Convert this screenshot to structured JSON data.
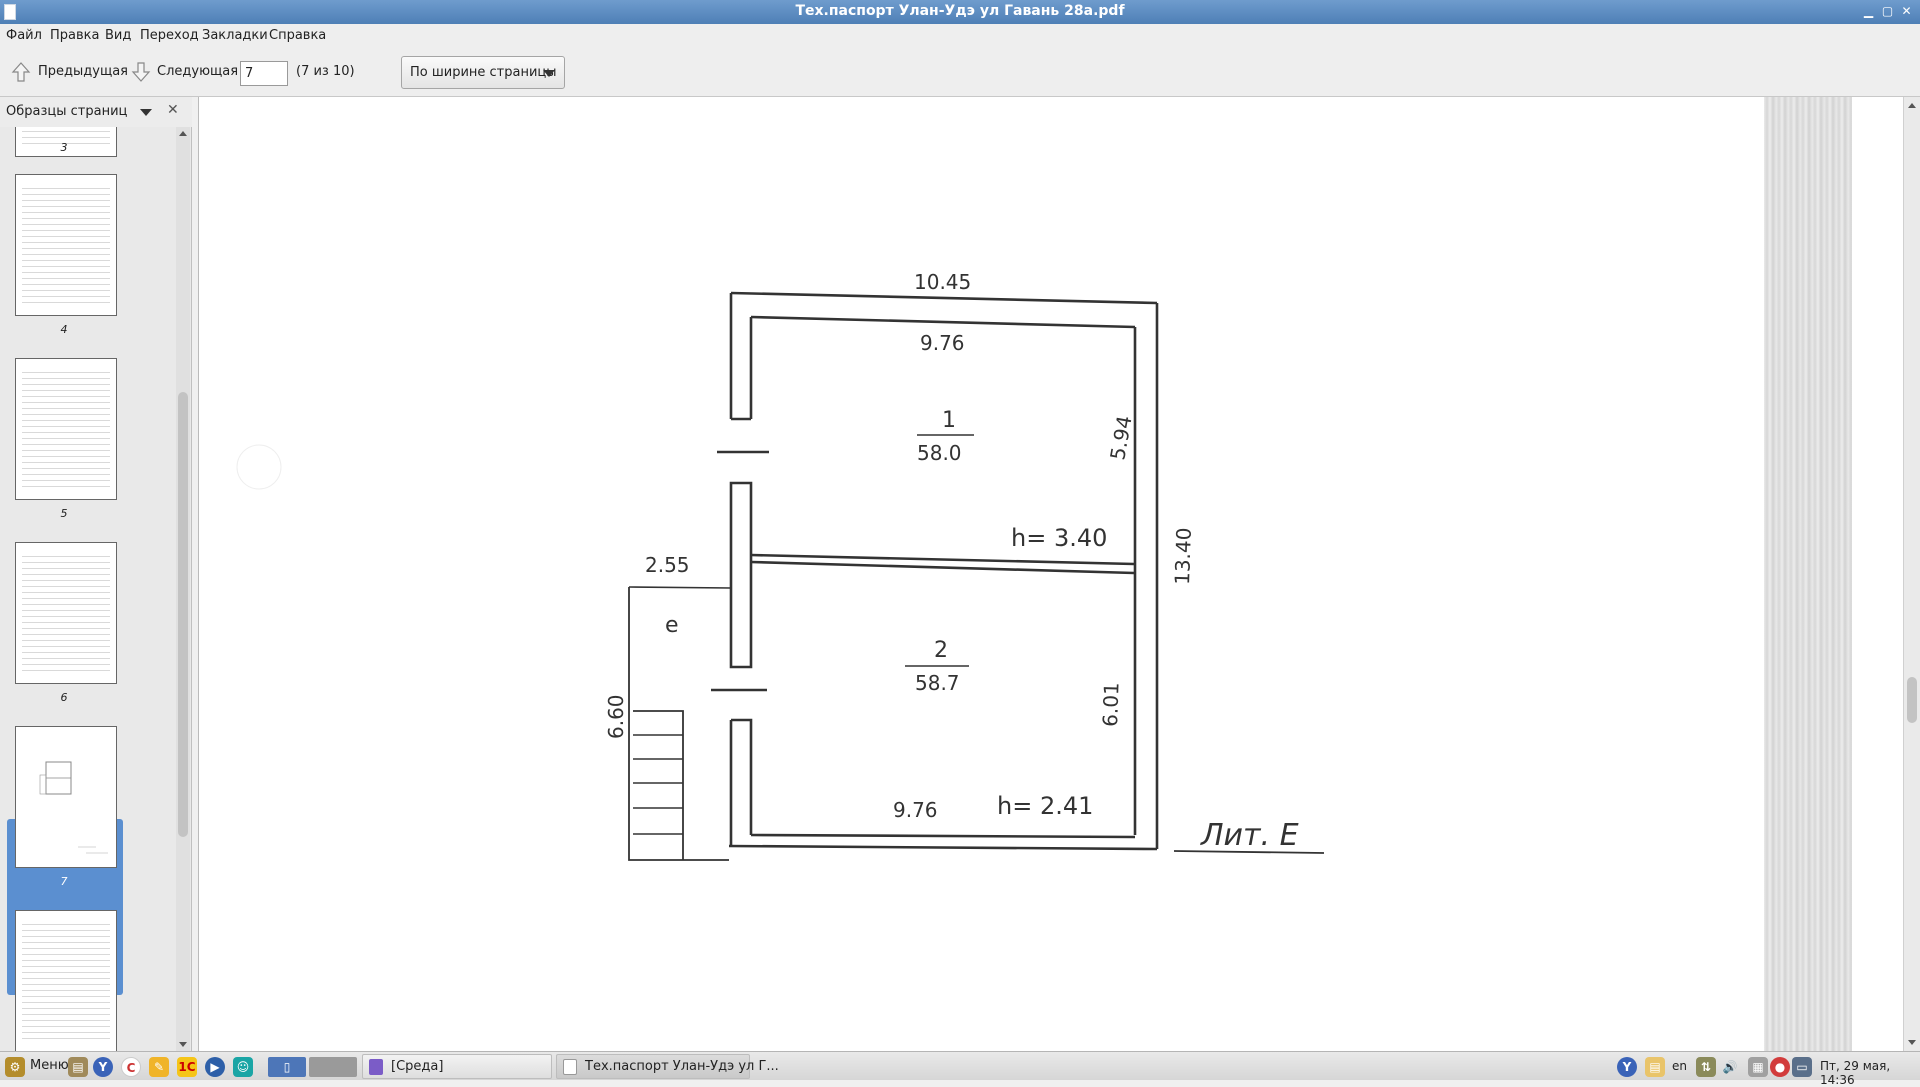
{
  "window": {
    "title": "Тех.паспорт Улан-Удэ ул Гавань 28а.pdf"
  },
  "menu": [
    "Файл",
    "Правка",
    "Вид",
    "Переход",
    "Закладки",
    "Справка"
  ],
  "toolbar": {
    "prev_label": "Предыдущая",
    "next_label": "Следующая",
    "page_value": "7",
    "page_count": "(7 из 10)",
    "zoom_label": "По ширине страницы"
  },
  "sidebar": {
    "title": "Образцы страниц",
    "thumbnails": [
      "3",
      "4",
      "5",
      "6",
      "7",
      ""
    ],
    "selected": "7"
  },
  "plan": {
    "top_outer": "10.45",
    "top_inner": "9.76",
    "room1_number": "1",
    "room1_area": "58.0",
    "room1_height": "h= 3.40",
    "right_upper": "5.94",
    "right_total": "13.40",
    "room2_number": "2",
    "room2_area": "58.7",
    "room2_height": "h= 2.41",
    "right_lower": "6.01",
    "bottom_inner": "9.76",
    "porch_width": "2.55",
    "porch_letter": "е",
    "porch_length": "6.60",
    "building_label": "Лит. Е"
  },
  "taskbar": {
    "menu_label": "Меню",
    "tasks": [
      "[Среда]",
      "Тех.паспорт Улан-Удэ ул Г..."
    ],
    "lang": "en",
    "clock": "Пт, 29 мая, 14:36"
  }
}
